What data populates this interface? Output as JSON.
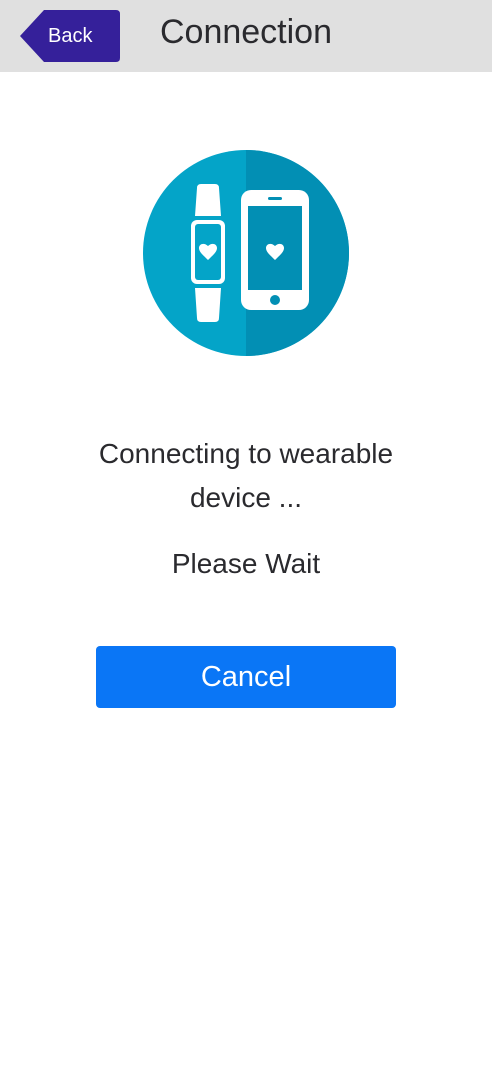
{
  "header": {
    "back_label": "Back",
    "title": "Connection"
  },
  "main": {
    "illustration_icon": "wearable-phone-connection-icon",
    "status_message": "Connecting to wearable device ...",
    "wait_message": "Please Wait",
    "cancel_label": "Cancel"
  },
  "colors": {
    "header_bg": "#e0e0e0",
    "back_button": "#35209a",
    "circle_light": "#04a4c8",
    "circle_dark": "#028fb4",
    "accent_button": "#0a76f6"
  }
}
